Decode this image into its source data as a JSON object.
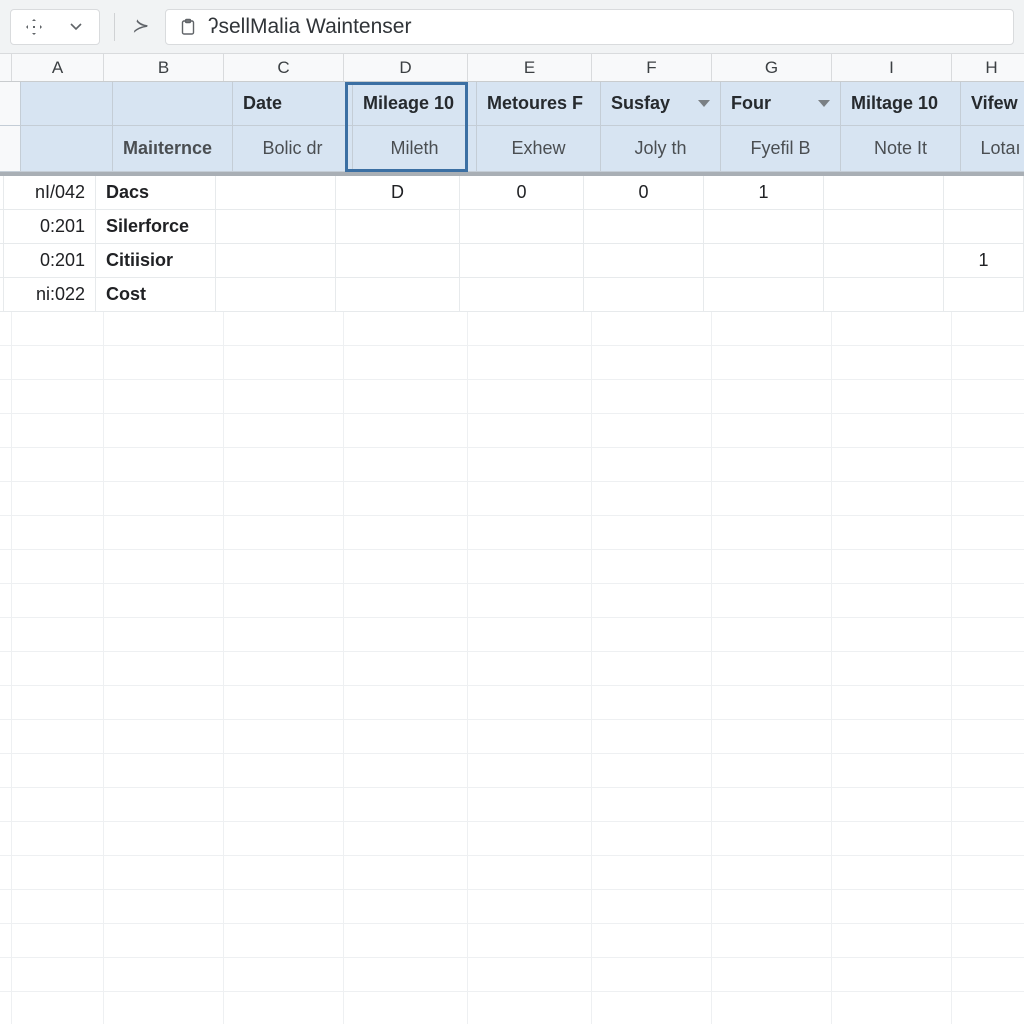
{
  "toolbar": {
    "cell_ref_glyph": "⊕",
    "fx_glyph": "≻"
  },
  "formula": {
    "text": "ʔsellMalia Waintenser"
  },
  "columns": [
    "A",
    "B",
    "C",
    "D",
    "E",
    "F",
    "G",
    "I",
    "H"
  ],
  "header1": {
    "A": "",
    "B": "",
    "C": "Date",
    "D": "Mileage 10",
    "E": "Metoures F",
    "F": "Susfay",
    "G": "Four",
    "I": "Miltage 10",
    "H": "Vifew"
  },
  "header2": {
    "A": "",
    "B": "Maiıternce",
    "C": "Bolic dr",
    "D": "Mileth",
    "E": "Exhew",
    "F": "Joly th",
    "G": "Fyefil B",
    "I": "Note It",
    "H": "Lotaı"
  },
  "filters": {
    "F": true,
    "G": true
  },
  "rows": [
    {
      "A": "nI/042",
      "B": "Dacs",
      "C": "",
      "D": "D",
      "E": "0",
      "F": "0",
      "G": "1",
      "I": "",
      "H": ""
    },
    {
      "A": " 0:201",
      "B": "Silerforce",
      "C": "",
      "D": "",
      "E": "",
      "F": "",
      "G": "",
      "I": "",
      "H": ""
    },
    {
      "A": " 0:201",
      "B": "Citiisior",
      "C": "",
      "D": "",
      "E": "",
      "F": "",
      "G": "",
      "I": "",
      "H": "1"
    },
    {
      "A": "ni:022",
      "B": "Cost",
      "C": "",
      "D": "",
      "E": "",
      "F": "",
      "G": "",
      "I": "",
      "H": ""
    }
  ],
  "selected_cell": "D-header1"
}
